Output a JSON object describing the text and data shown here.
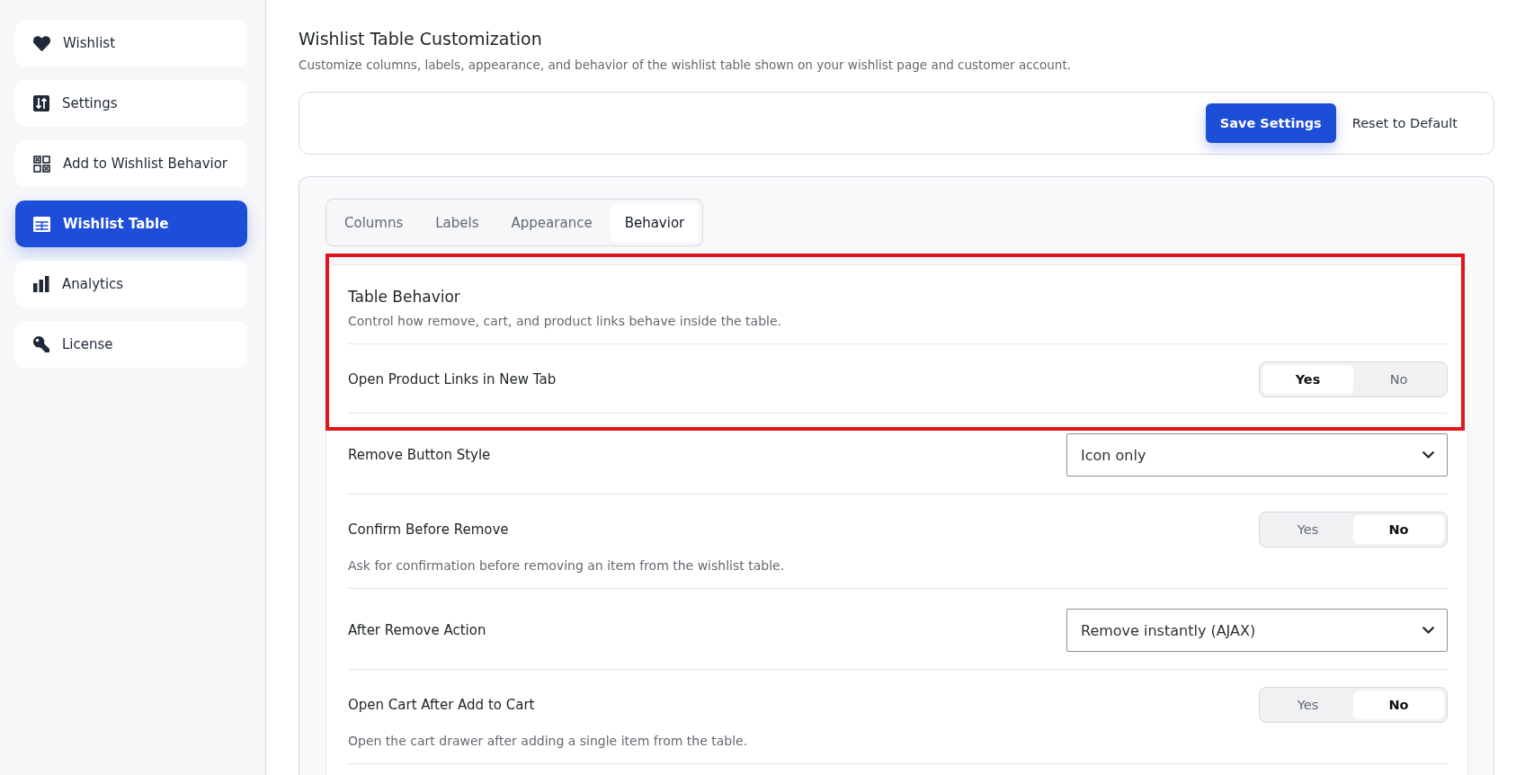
{
  "sidebar": {
    "items": [
      {
        "label": "Wishlist",
        "selected": false
      },
      {
        "label": "Settings",
        "selected": false
      },
      {
        "label": "Add to Wishlist Behavior",
        "selected": false
      },
      {
        "label": "Wishlist Table",
        "selected": true
      },
      {
        "label": "Analytics",
        "selected": false
      },
      {
        "label": "License",
        "selected": false
      }
    ]
  },
  "header": {
    "title": "Wishlist Table Customization",
    "description": "Customize columns, labels, appearance, and behavior of the wishlist table shown on your wishlist page and customer account."
  },
  "actions": {
    "save": "Save Settings",
    "reset": "Reset to Default"
  },
  "tabs": [
    {
      "label": "Columns",
      "selected": false
    },
    {
      "label": "Labels",
      "selected": false
    },
    {
      "label": "Appearance",
      "selected": false
    },
    {
      "label": "Behavior",
      "selected": true
    }
  ],
  "section": {
    "title": "Table Behavior",
    "description": "Control how remove, cart, and product links behave inside the table.",
    "highlighted": true
  },
  "settings": [
    {
      "kind": "toggle",
      "label": "Open Product Links in New Tab",
      "options": [
        {
          "label": "Yes",
          "selected": true
        },
        {
          "label": "No",
          "selected": false
        }
      ]
    },
    {
      "kind": "select",
      "label": "Remove Button Style",
      "value": "Icon only"
    },
    {
      "kind": "toggle",
      "label": "Confirm Before Remove",
      "options": [
        {
          "label": "Yes",
          "selected": false
        },
        {
          "label": "No",
          "selected": true
        }
      ],
      "help": "Ask for confirmation before removing an item from the wishlist table."
    },
    {
      "kind": "select",
      "label": "After Remove Action",
      "value": "Remove instantly (AJAX)"
    },
    {
      "kind": "toggle",
      "label": "Open Cart After Add to Cart",
      "options": [
        {
          "label": "Yes",
          "selected": false
        },
        {
          "label": "No",
          "selected": true
        }
      ],
      "help": "Open the cart drawer after adding a single item from the table."
    }
  ]
}
